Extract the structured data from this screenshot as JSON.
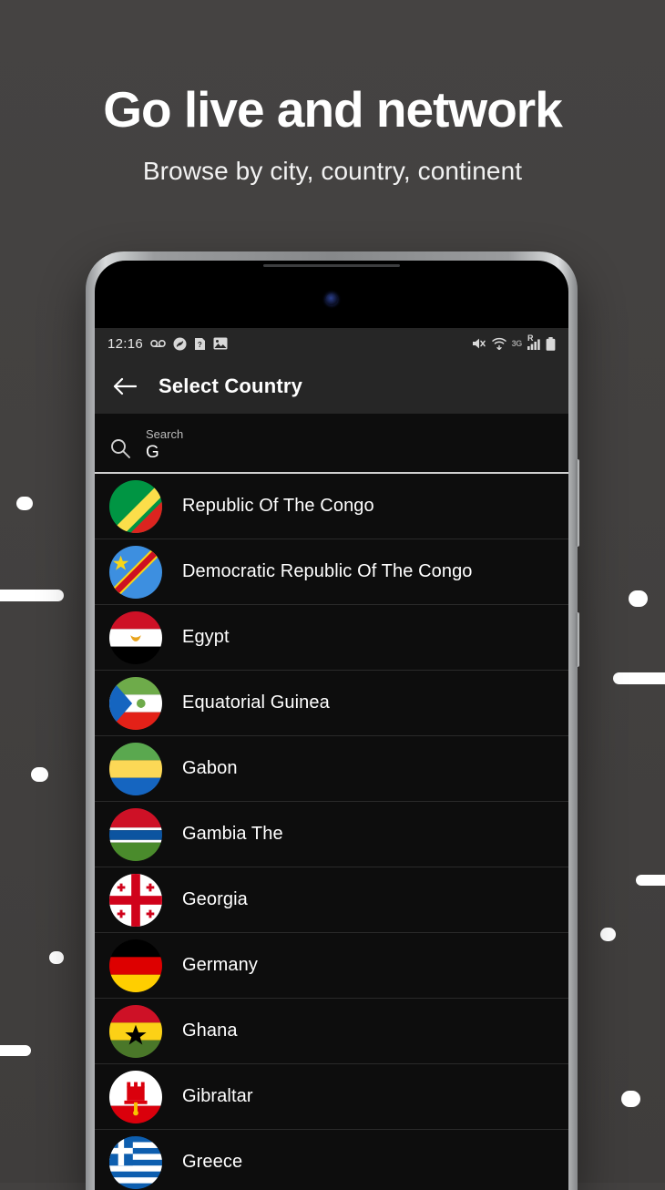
{
  "hero": {
    "title": "Go live and network",
    "subtitle": "Browse by city, country, continent"
  },
  "colors": {
    "background": "#434140",
    "screen": "#0d0d0d",
    "appbar": "#262626",
    "text": "#ffffff"
  },
  "phone": {
    "statusbar": {
      "time": "12:16",
      "left_icons": [
        "voicemail-icon",
        "shazam-icon",
        "help-document-icon",
        "image-icon"
      ],
      "right_icons": [
        "mute-icon",
        "wifi-icon",
        "battery-icon"
      ],
      "network_label": "3G",
      "roaming_label": "R"
    },
    "appbar": {
      "back_label": "back-arrow",
      "title": "Select Country"
    },
    "search": {
      "label": "Search",
      "value": "G",
      "placeholder": "Search"
    },
    "countries": [
      {
        "name": "Republic Of The Congo",
        "flag": "congo-republic"
      },
      {
        "name": "Democratic Republic Of The Congo",
        "flag": "congo-democratic"
      },
      {
        "name": "Egypt",
        "flag": "egypt"
      },
      {
        "name": "Equatorial Guinea",
        "flag": "equatorial-guinea"
      },
      {
        "name": "Gabon",
        "flag": "gabon"
      },
      {
        "name": "Gambia The",
        "flag": "gambia"
      },
      {
        "name": "Georgia",
        "flag": "georgia"
      },
      {
        "name": "Germany",
        "flag": "germany"
      },
      {
        "name": "Ghana",
        "flag": "ghana"
      },
      {
        "name": "Gibraltar",
        "flag": "gibraltar"
      },
      {
        "name": "Greece",
        "flag": "greece"
      }
    ]
  }
}
